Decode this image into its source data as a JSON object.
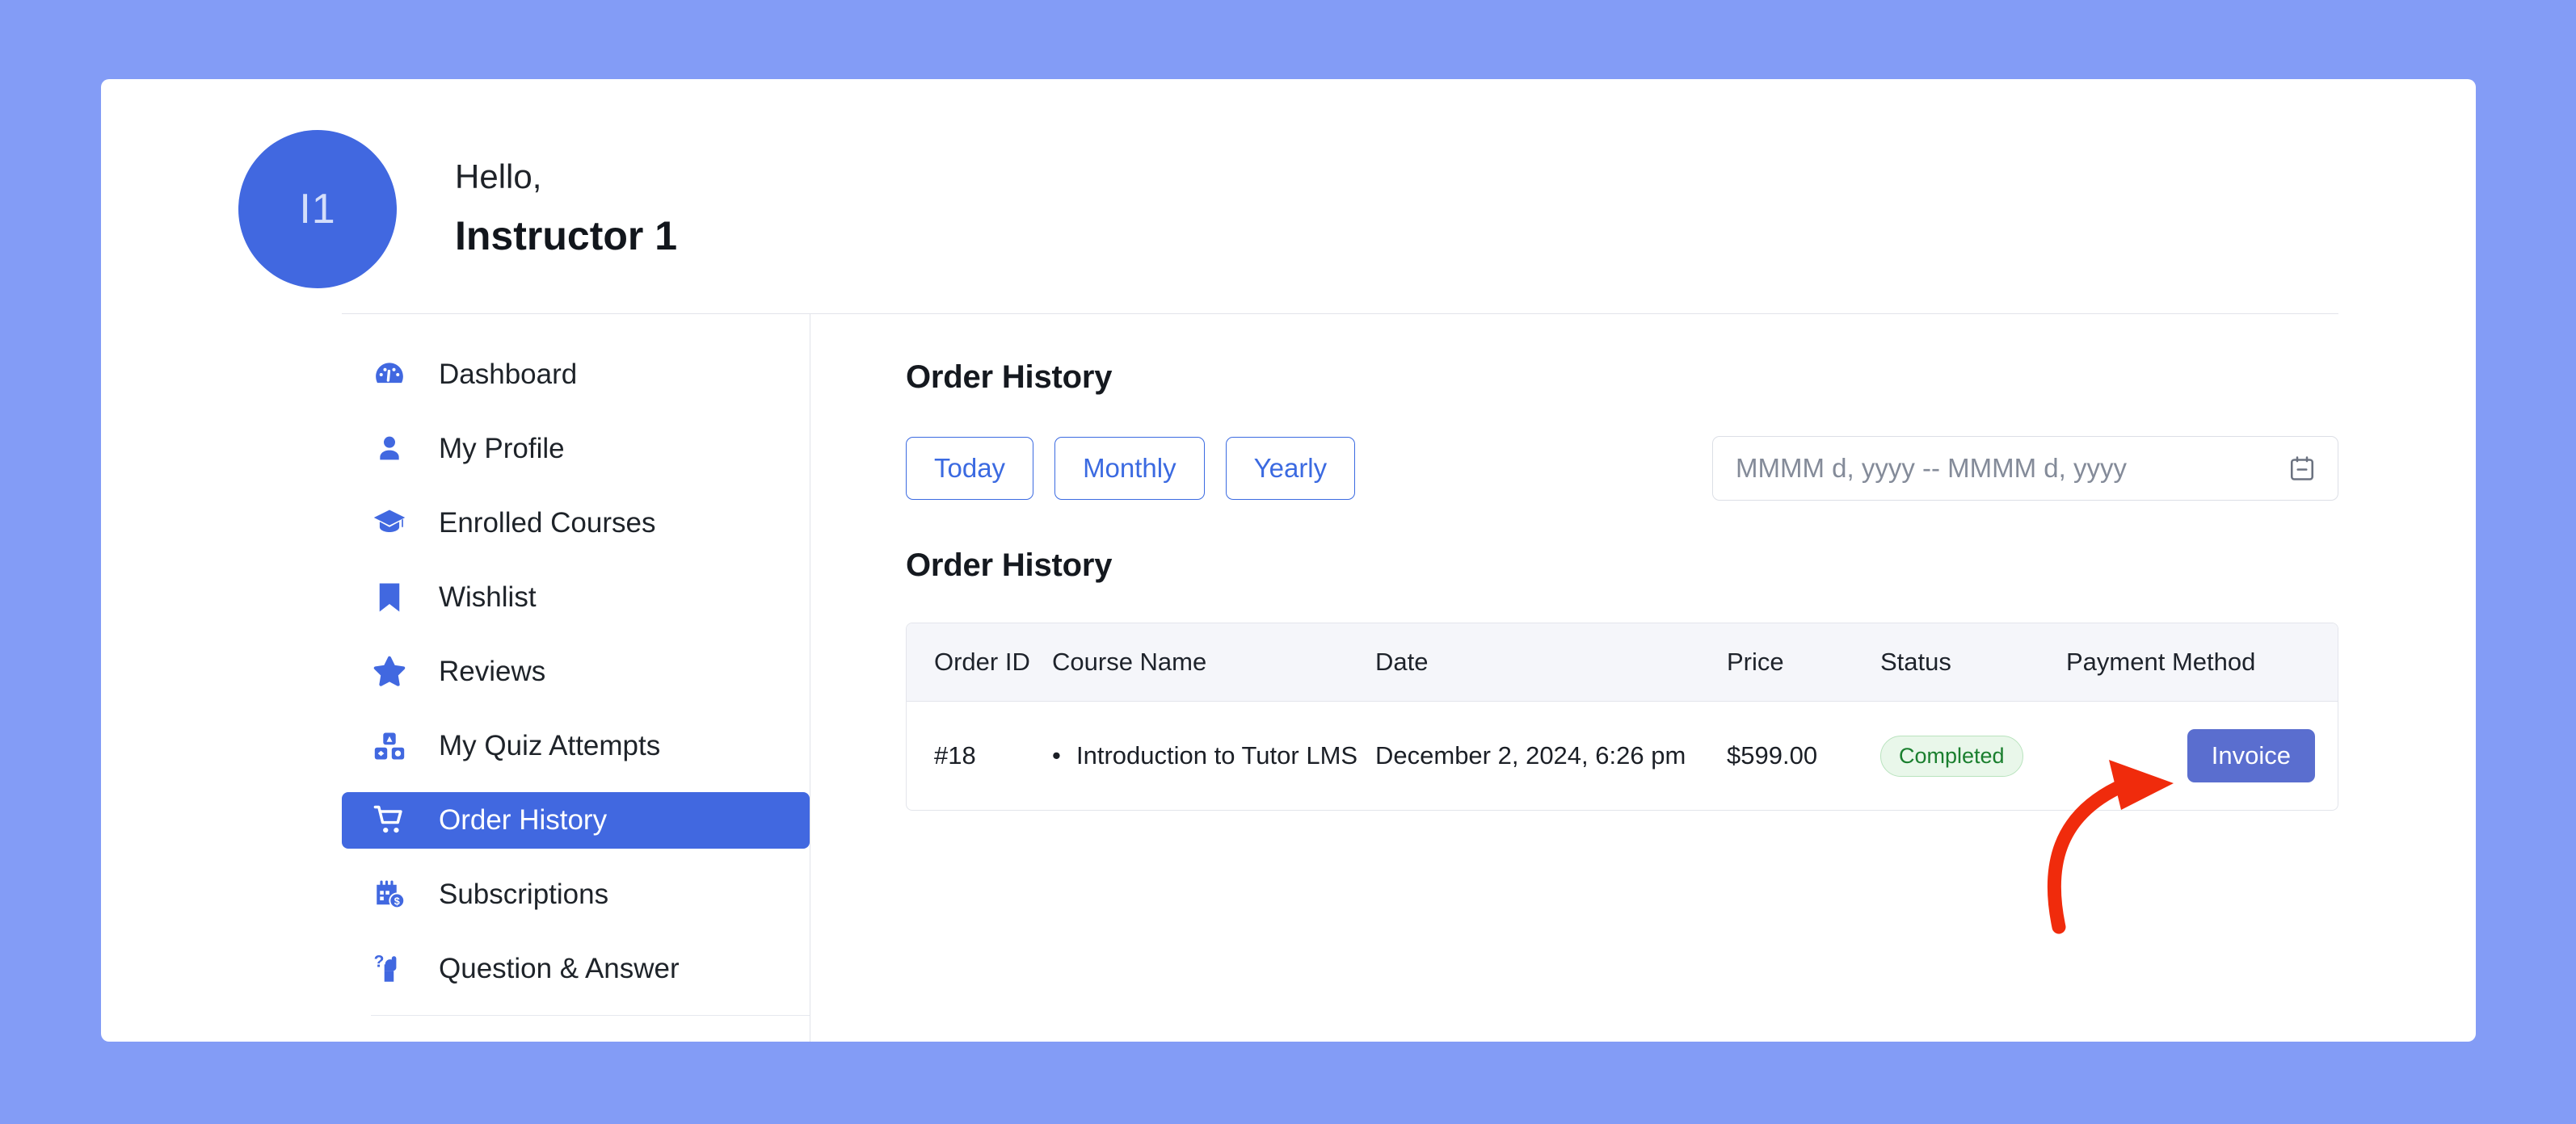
{
  "theme": {
    "page_background": "#839CF6",
    "accent": "#4168E0",
    "filter_border": "#3B6AE1",
    "invoice_button": "#5A6ECF",
    "badge_text": "#1A7F2E",
    "badge_background": "#E9F7EA",
    "annotation_arrow": "#F02B0C"
  },
  "greeting": {
    "avatar_initials": "I1",
    "hello": "Hello,",
    "username": "Instructor 1"
  },
  "sidebar": {
    "items": [
      {
        "label": "Dashboard",
        "icon": "dashboard-icon",
        "active": false
      },
      {
        "label": "My Profile",
        "icon": "user-icon",
        "active": false
      },
      {
        "label": "Enrolled Courses",
        "icon": "graduation-cap-icon",
        "active": false
      },
      {
        "label": "Wishlist",
        "icon": "bookmark-icon",
        "active": false
      },
      {
        "label": "Reviews",
        "icon": "star-icon",
        "active": false
      },
      {
        "label": "My Quiz Attempts",
        "icon": "blocks-icon",
        "active": false
      },
      {
        "label": "Order History",
        "icon": "cart-icon",
        "active": true
      },
      {
        "label": "Subscriptions",
        "icon": "calendar-dollar-icon",
        "active": false
      },
      {
        "label": "Question & Answer",
        "icon": "question-person-icon",
        "active": false
      }
    ]
  },
  "main": {
    "page_title": "Order History",
    "table_title": "Order History",
    "filters": [
      {
        "label": "Today"
      },
      {
        "label": "Monthly"
      },
      {
        "label": "Yearly"
      }
    ],
    "date_range": {
      "value": "",
      "placeholder": "MMMM d, yyyy -- MMMM d, yyyy",
      "icon": "calendar-icon"
    },
    "table": {
      "columns": [
        "Order ID",
        "Course Name",
        "Date",
        "Price",
        "Status",
        "Payment Method"
      ],
      "rows": [
        {
          "order_id": "#18",
          "course_name": "Introduction to Tutor LMS",
          "date": "December 2, 2024, 6:26 pm",
          "price": "$599.00",
          "status": "Completed",
          "action_label": "Invoice"
        }
      ]
    }
  }
}
